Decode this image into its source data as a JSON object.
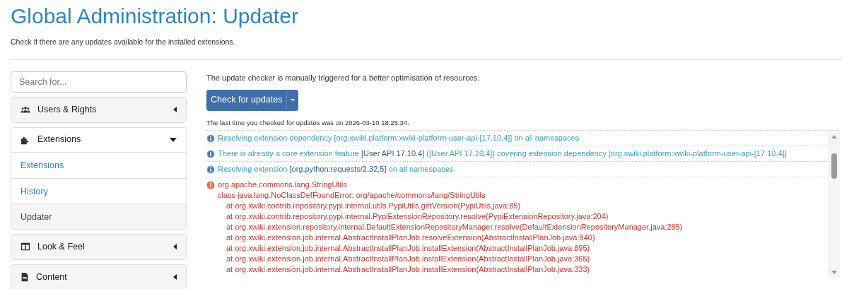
{
  "header": {
    "title": "Global Administration: Updater",
    "subtitle": "Check if there are any updates available for the installed extensions."
  },
  "sidebar": {
    "search": {
      "placeholder": "Search for..."
    },
    "categories": [
      {
        "label": "Users & Rights",
        "expanded": false
      },
      {
        "label": "Extensions",
        "expanded": true,
        "children": [
          {
            "label": "Extensions",
            "selected": false
          },
          {
            "label": "History",
            "selected": false
          },
          {
            "label": "Updater",
            "selected": true
          }
        ]
      },
      {
        "label": "Look & Feel",
        "expanded": false
      },
      {
        "label": "Content",
        "expanded": false
      }
    ]
  },
  "main": {
    "intro": "The update checker is manually triggered for a better optimisation of resources.",
    "button": "Check for updates",
    "last_check": "The last time you checked for updates was on 2026-03-10 18:25:34.",
    "log": [
      {
        "kind": "info",
        "segments": [
          {
            "text": "Resolving extension dependency ",
            "ref": false
          },
          {
            "text": "[org.xwiki.platform:xwiki-platform-user-api-[17.10.4]]",
            "ref": false
          },
          {
            "text": " on all namespaces",
            "ref": false
          }
        ]
      },
      {
        "kind": "info",
        "segments": [
          {
            "text": "There is already a core extension feature ",
            "ref": false
          },
          {
            "text": "[User API 17.10.4]",
            "ref": true
          },
          {
            "text": " ([User API 17.10.4]) covering extension dependency ",
            "ref": false
          },
          {
            "text": "[org.xwiki.platform:xwiki-platform-user-api-[17.10.4]]",
            "ref": false
          }
        ]
      },
      {
        "kind": "info",
        "segments": [
          {
            "text": "Resolving extension ",
            "ref": false
          },
          {
            "text": "[org.python:requests/2.32.5]",
            "ref": true
          },
          {
            "text": " on all namespaces",
            "ref": false
          }
        ]
      },
      {
        "kind": "error",
        "message": "org.apache.commons.lang.StringUtils",
        "detail": "class java.lang.NoClassDefFoundError: org/apache/commons/lang/StringUtils",
        "trace": [
          "at org.xwiki.contrib.repository.pypi.internal.utils.PypiUtils.getVersion(PypiUtils.java:85)",
          "at org.xwiki.contrib.repository.pypi.internal.PypiExtensionRepository.resolve(PypiExtensionRepository.java:204)",
          "at org.xwiki.extension.repository.internal.DefaultExtensionRepositoryManager.resolve(DefaultExtensionRepositoryManager.java:285)",
          "at org.xwiki.extension.job.internal.AbstractInstallPlanJob.resolveExtension(AbstractInstallPlanJob.java:940)",
          "at org.xwiki.extension.job.internal.AbstractInstallPlanJob.installExtension(AbstractInstallPlanJob.java:895)",
          "at org.xwiki.extension.job.internal.AbstractInstallPlanJob.installExtension(AbstractInstallPlanJob.java:365)",
          "at org.xwiki.extension.job.internal.AbstractInstallPlanJob.installExtension(AbstractInstallPlanJob.java:333)"
        ]
      }
    ]
  }
}
